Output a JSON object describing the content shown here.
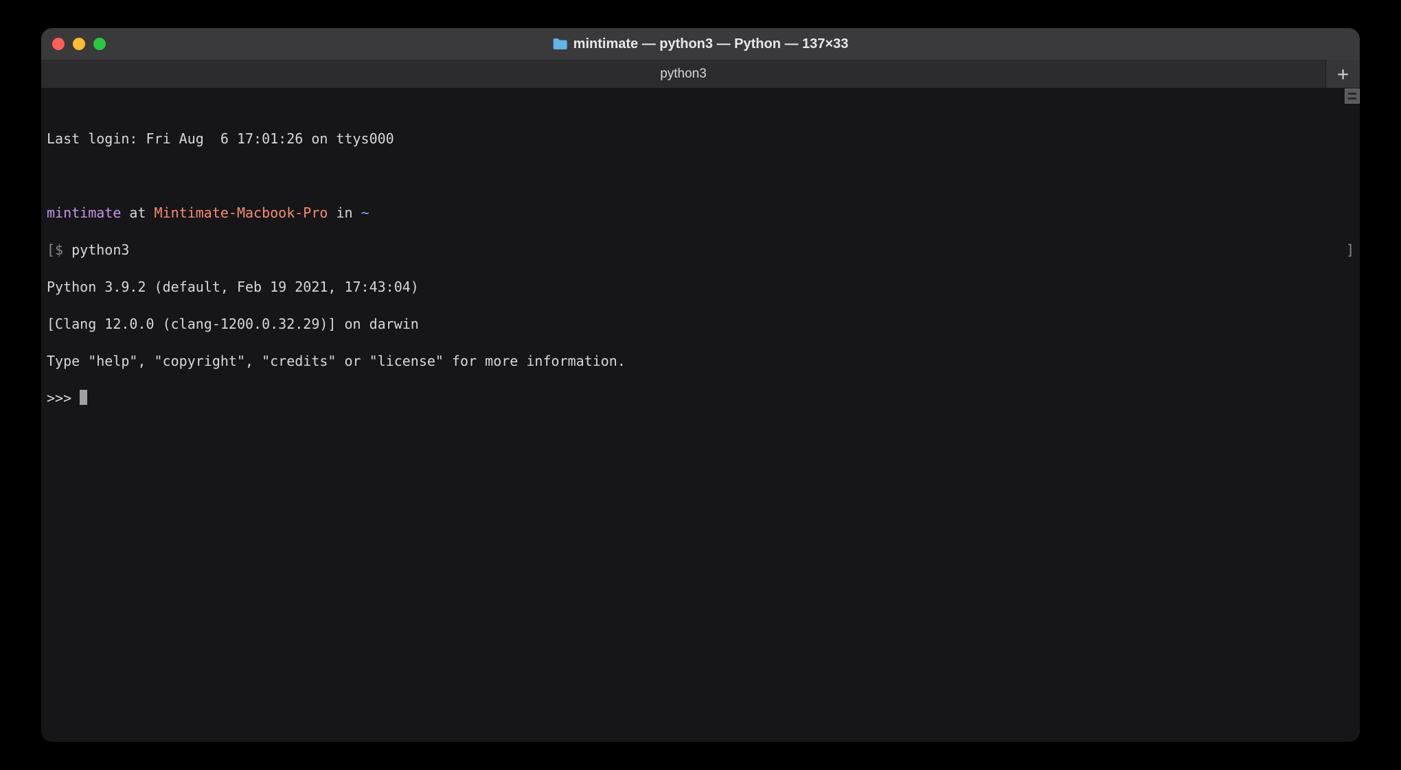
{
  "window": {
    "title": "mintimate — python3 — Python — 137×33"
  },
  "tab": {
    "label": "python3"
  },
  "terminal": {
    "last_login": "Last login: Fri Aug  6 17:01:26 on ttys000",
    "prompt": {
      "user": "mintimate",
      "at": " at ",
      "host": "Mintimate-Macbook-Pro",
      "in": " in ",
      "path": "~"
    },
    "shell_left": "[$ ",
    "shell_cmd": "python3",
    "shell_right": "]",
    "py_line1": "Python 3.9.2 (default, Feb 19 2021, 17:43:04) ",
    "py_line2": "[Clang 12.0.0 (clang-1200.0.32.29)] on darwin",
    "py_line3": "Type \"help\", \"copyright\", \"credits\" or \"license\" for more information.",
    "repl_prompt": ">>> "
  }
}
